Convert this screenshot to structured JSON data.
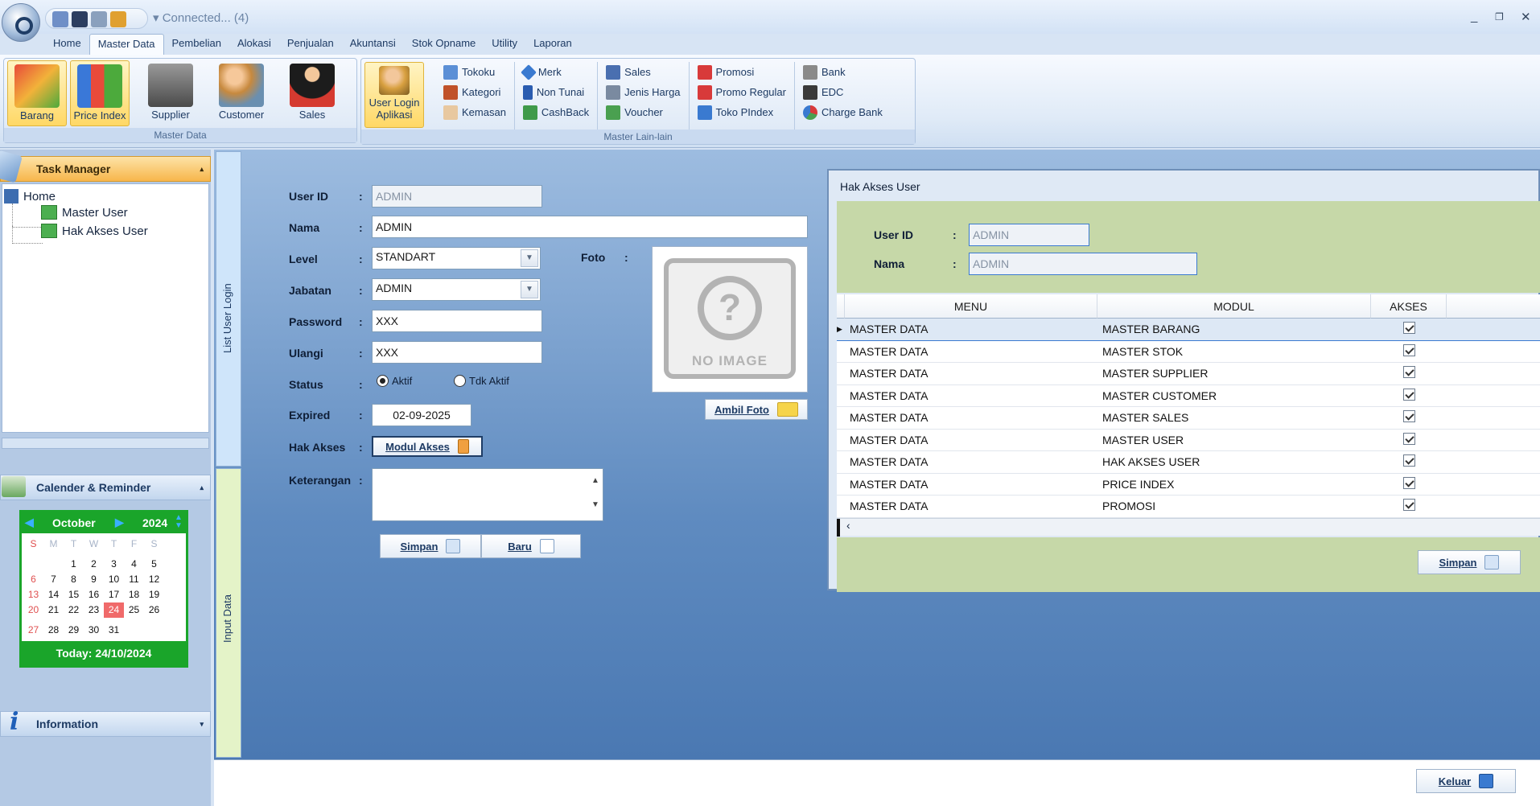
{
  "titlebar": {
    "connection": "Connected... (4)",
    "minimize": "_",
    "restore": "❐",
    "close": "✕"
  },
  "menu": [
    "Home",
    "Master Data",
    "Pembelian",
    "Alokasi",
    "Penjualan",
    "Akuntansi",
    "Stok Opname",
    "Utility",
    "Laporan"
  ],
  "ribbon": {
    "master_data": {
      "label": "Master Data",
      "buttons": [
        "Barang",
        "Price Index",
        "Supplier",
        "Customer",
        "Sales"
      ]
    },
    "user_login": {
      "line1": "User Login",
      "line2": "Aplikasi"
    },
    "master_lain": {
      "label": "Master Lain-lain",
      "col1": [
        "Tokoku",
        "Kategori",
        "Kemasan"
      ],
      "col2": [
        "Merk",
        "Non Tunai",
        "CashBack"
      ],
      "col3": [
        "Sales",
        "Jenis Harga",
        "Voucher"
      ],
      "col4": [
        "Promosi",
        "Promo Regular",
        "Toko PIndex"
      ],
      "col5": [
        "Bank",
        "EDC",
        "Charge Bank"
      ]
    }
  },
  "task_manager": {
    "title": "Task Manager",
    "home": "Home",
    "items": [
      "Master User",
      "Hak Akses User"
    ]
  },
  "calendar": {
    "title": "Calender & Reminder",
    "month": "October",
    "year": "2024",
    "weekdays": [
      "S",
      "M",
      "T",
      "W",
      "T",
      "F",
      "S"
    ],
    "weeks": [
      [
        "",
        "",
        "1",
        "2",
        "3",
        "4",
        "5"
      ],
      [
        "6",
        "7",
        "8",
        "9",
        "10",
        "11",
        "12"
      ],
      [
        "13",
        "14",
        "15",
        "16",
        "17",
        "18",
        "19"
      ],
      [
        "20",
        "21",
        "22",
        "23",
        "24",
        "25",
        "26"
      ],
      [
        "27",
        "28",
        "29",
        "30",
        "31",
        "",
        ""
      ]
    ],
    "today": "Today: 24/10/2024"
  },
  "information": {
    "title": "Information"
  },
  "vtabs": {
    "list": "List User Login",
    "input": "Input Data"
  },
  "form": {
    "user_id_label": "User ID",
    "user_id": "ADMIN",
    "nama_label": "Nama",
    "nama": "ADMIN",
    "level_label": "Level",
    "level": "STANDART",
    "jabatan_label": "Jabatan",
    "jabatan": "ADMIN",
    "password_label": "Password",
    "password": "XXX",
    "ulangi_label": "Ulangi",
    "ulangi": "XXX",
    "status_label": "Status",
    "status_aktif": "Aktif",
    "status_tdk": "Tdk Aktif",
    "expired_label": "Expired",
    "expired": "02-09-2025",
    "hak_akses_label": "Hak Akses",
    "modul_akses": "Modul Akses",
    "keterangan_label": "Keterangan",
    "foto_label": "Foto",
    "no_image": "NO IMAGE",
    "ambil_foto": "Ambil Foto",
    "simpan": "Simpan",
    "baru": "Baru",
    "colon": ":"
  },
  "dialog": {
    "title": "Hak Akses User",
    "user_id_label": "User ID",
    "user_id": "ADMIN",
    "nama_label": "Nama",
    "nama": "ADMIN",
    "columns": [
      "MENU",
      "MODUL",
      "AKSES"
    ],
    "rows": [
      [
        "MASTER DATA",
        "MASTER BARANG"
      ],
      [
        "MASTER DATA",
        "MASTER STOK"
      ],
      [
        "MASTER DATA",
        "MASTER SUPPLIER"
      ],
      [
        "MASTER DATA",
        "MASTER CUSTOMER"
      ],
      [
        "MASTER DATA",
        "MASTER SALES"
      ],
      [
        "MASTER DATA",
        "MASTER USER"
      ],
      [
        "MASTER DATA",
        "HAK AKSES USER"
      ],
      [
        "MASTER DATA",
        "PRICE INDEX"
      ],
      [
        "MASTER DATA",
        "PROMOSI"
      ]
    ],
    "simpan": "Simpan"
  },
  "keluar": "Keluar"
}
